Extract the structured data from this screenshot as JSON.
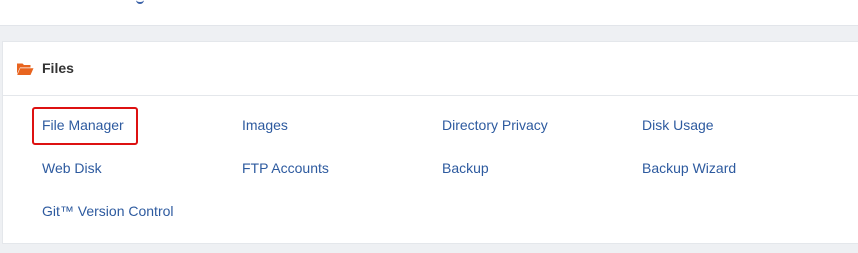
{
  "files_panel": {
    "title": "Files",
    "icon": "folder-open-icon",
    "accent_color": "#e8641f",
    "link_color": "#2d5a9f",
    "highlighted_item": "File Manager",
    "items": [
      "File Manager",
      "Images",
      "Directory Privacy",
      "Disk Usage",
      "Web Disk",
      "FTP Accounts",
      "Backup",
      "Backup Wizard",
      "Git™ Version Control"
    ]
  }
}
